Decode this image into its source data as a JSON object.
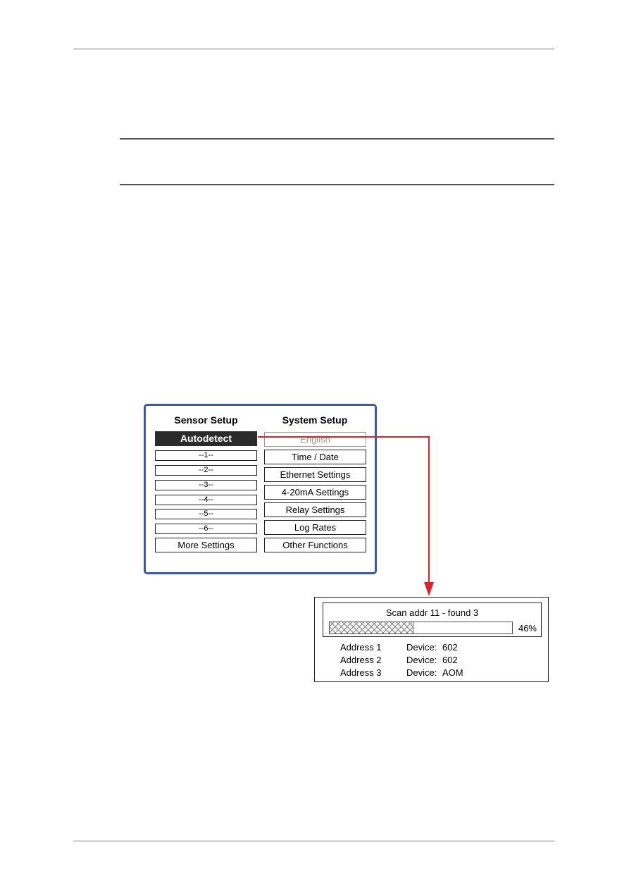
{
  "panel": {
    "sensor_setup": {
      "title": "Sensor Setup",
      "items": [
        {
          "label": "Autodetect",
          "state": "selected"
        },
        {
          "label": "--1--"
        },
        {
          "label": "--2--"
        },
        {
          "label": "--3--"
        },
        {
          "label": "--4--"
        },
        {
          "label": "--5--"
        },
        {
          "label": "--6--"
        },
        {
          "label": "More Settings"
        }
      ]
    },
    "system_setup": {
      "title": "System Setup",
      "items": [
        {
          "label": "English",
          "state": "disabled"
        },
        {
          "label": "Time / Date"
        },
        {
          "label": "Ethernet Settings"
        },
        {
          "label": "4-20mA Settings"
        },
        {
          "label": "Relay Settings"
        },
        {
          "label": "Log Rates"
        },
        {
          "label": "Other Functions"
        }
      ]
    }
  },
  "scan_dialog": {
    "status": "Scan addr 11 - found 3",
    "progress_percent": 46,
    "progress_label": "46%",
    "results": [
      {
        "address": "Address 1",
        "device_label": "Device:",
        "device": "602"
      },
      {
        "address": "Address 2",
        "device_label": "Device:",
        "device": "602"
      },
      {
        "address": "Address 3",
        "device_label": "Device:",
        "device": "AOM"
      }
    ]
  },
  "colors": {
    "panel_border": "#3b5ba5",
    "arrow": "#e0202a",
    "selected_bg": "#2b2b2b"
  }
}
